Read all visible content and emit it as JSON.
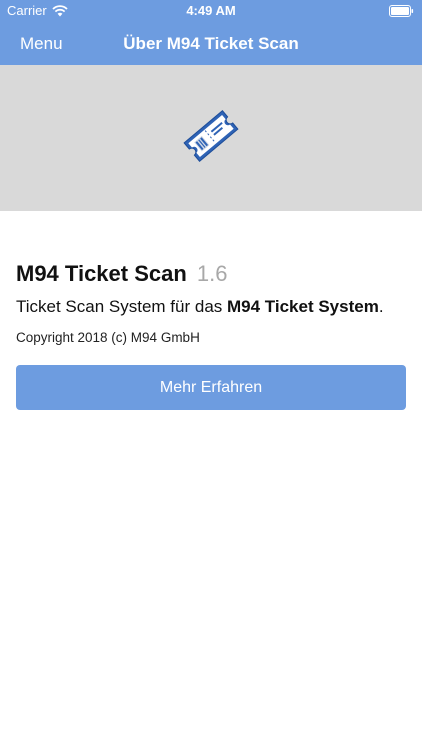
{
  "status_bar": {
    "carrier": "Carrier",
    "time": "4:49 AM"
  },
  "nav": {
    "menu_label": "Menu",
    "title": "Über M94 Ticket Scan"
  },
  "hero": {
    "icon": "ticket-icon"
  },
  "about": {
    "app_name": "M94 Ticket Scan",
    "version": "1.6",
    "description_prefix": "Ticket Scan System für das ",
    "description_bold": "M94 Ticket System",
    "description_suffix": ".",
    "copyright": "Copyright 2018 (c) M94 GmbH"
  },
  "actions": {
    "more_label": "Mehr Erfahren"
  },
  "colors": {
    "accent": "#6d9ce0",
    "hero_bg": "#d9d9d9",
    "version_gray": "#a8a8a8"
  }
}
